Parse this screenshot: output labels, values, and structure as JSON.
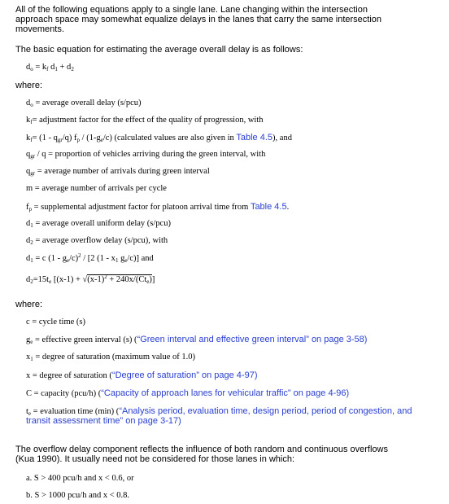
{
  "intro": "All of the following equations apply to a single lane. Lane changing within the intersection approach space may somewhat equalize delays in the lanes that carry the same intersection movements.",
  "basic_eq_text": "The basic equation for estimating the average overall delay is as follows:",
  "where1": "where:",
  "where2": "where:",
  "defs": {
    "do_text": "= average overall delay (s/pcu)",
    "kf_text": "= adjustment factor for the effect of the quality of progression, with",
    "kf_eq_tail": "(calculated values are also given in",
    "kf_link": "Table 4.5",
    "kf_end": "), and",
    "qgrq_text": "= proportion of vehicles arriving during the green interval, with",
    "qgr_text": "= average number of arrivals during green interval",
    "m_text": "m = average number of arrivals per cycle",
    "fp_text": "= supplemental adjustment factor for platoon arrival time from",
    "fp_link": "Table 4.5",
    "fp_end": ".",
    "d1_text": "= average overall uniform delay (s/pcu)",
    "d2_text": "= average overflow delay (s/pcu), with",
    "and_text": "and"
  },
  "vars": {
    "c_text": "c = cycle time (s)",
    "ge_text": "= effective green interval (s) (",
    "ge_link": "“Green interval and effective green interval” on page 3-58",
    "ge_end": ")",
    "x1_text": "= degree of saturation (maximum value of 1.0)",
    "x_text": "x = degree of saturation (",
    "x_link": "“Degree of saturation” on page 4-97",
    "x_end": ")",
    "C_text": "C = capacity (pcu/h) (",
    "C_link": "“Capacity of approach lanes for vehicular traffic” on page 4-96",
    "C_end": ")",
    "te_text": "= evaluation time (min) (",
    "te_link_1": "“Analysis period, evaluation time, design period, period of congestion, and",
    "te_link_2": "transit assessment time” on page 3-17",
    "te_end": ")"
  },
  "overflow_para": "The overflow delay component reflects the influence of both random and continuous overflows (Kua 1990). It usually need not be considered for those lanes in which:",
  "conditions": {
    "a": "a. S > 400 pcu/h and x < 0.6, or",
    "b": "b. S > 1000 pcu/h and x < 0.8."
  }
}
